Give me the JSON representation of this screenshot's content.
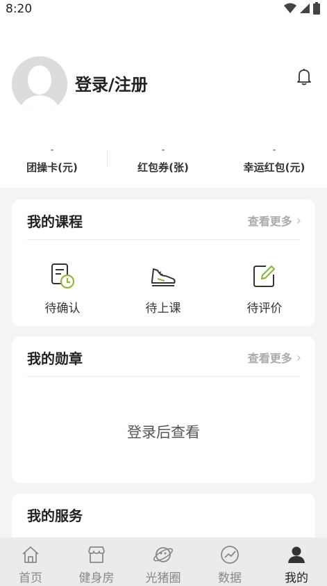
{
  "status_bar": {
    "time": "8:20"
  },
  "profile": {
    "login_label": "登录/注册"
  },
  "stats": [
    {
      "value": "-",
      "label": "团操卡(元)"
    },
    {
      "value": "-",
      "label": "红包券(张)"
    },
    {
      "value": "-",
      "label": "幸运红包(元)"
    }
  ],
  "courses_card": {
    "title": "我的课程",
    "more": "查看更多",
    "items": [
      {
        "label": "待确认",
        "icon": "pending-confirm-icon"
      },
      {
        "label": "待上课",
        "icon": "sneaker-icon"
      },
      {
        "label": "待评价",
        "icon": "edit-review-icon"
      }
    ]
  },
  "medals_card": {
    "title": "我的勋章",
    "more": "查看更多",
    "empty_text": "登录后查看"
  },
  "services_card": {
    "title": "我的服务"
  },
  "tabbar": {
    "items": [
      {
        "label": "首页",
        "icon": "home-icon"
      },
      {
        "label": "健身房",
        "icon": "gym-store-icon"
      },
      {
        "label": "光猪圈",
        "icon": "planet-icon"
      },
      {
        "label": "数据",
        "icon": "chart-icon"
      },
      {
        "label": "我的",
        "icon": "user-icon"
      }
    ],
    "active": "我的"
  },
  "colors": {
    "accent_green": "#8cb83a",
    "background": "#f4f4f4"
  }
}
